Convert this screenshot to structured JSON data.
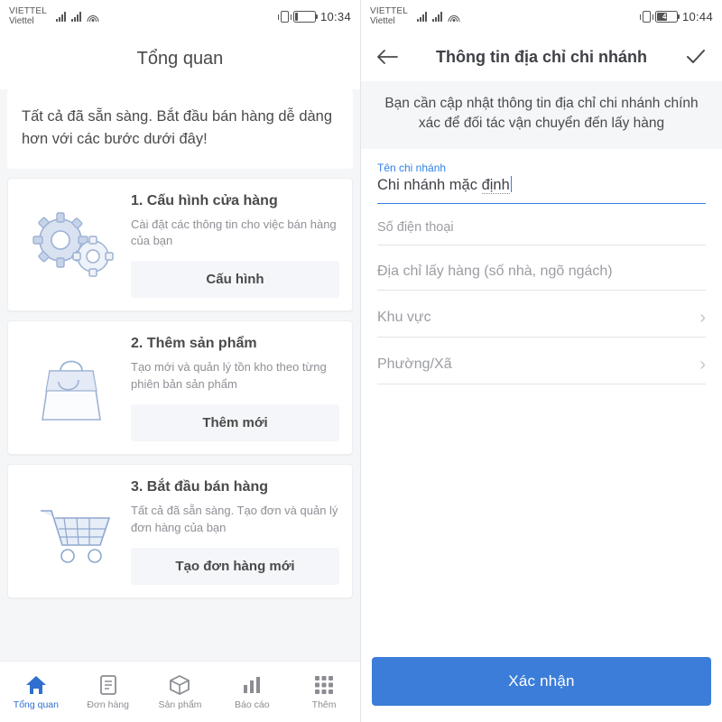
{
  "left": {
    "status": {
      "carrier_line1": "VIETTEL",
      "carrier_line2": "Viettel",
      "battery_level": "5",
      "clock": "10:34"
    },
    "title": "Tổng quan",
    "intro": "Tất cả đã sẵn sàng. Bắt đầu bán hàng dễ dàng hơn với các bước dưới đây!",
    "cards": [
      {
        "illus": "gears-illustration",
        "title": "1. Cấu hình cửa hàng",
        "desc": "Cài đặt các thông tin cho việc bán hàng của bạn",
        "button": "Cấu hình"
      },
      {
        "illus": "shopping-bag-illustration",
        "title": "2. Thêm sản phẩm",
        "desc": "Tạo mới và quản lý tồn kho theo từng phiên bản sản phẩm",
        "button": "Thêm mới"
      },
      {
        "illus": "shopping-cart-illustration",
        "title": "3. Bắt đầu bán hàng",
        "desc": "Tất cả đã sẵn sàng. Tạo đơn và quản lý đơn hàng của bạn",
        "button": "Tạo đơn hàng mới"
      }
    ],
    "nav": [
      {
        "icon": "home-icon",
        "label": "Tổng quan",
        "active": true
      },
      {
        "icon": "orders-icon",
        "label": "Đơn hàng",
        "active": false
      },
      {
        "icon": "product-box-icon",
        "label": "Sản phẩm",
        "active": false
      },
      {
        "icon": "report-chart-icon",
        "label": "Báo cáo",
        "active": false
      },
      {
        "icon": "grid-more-icon",
        "label": "Thêm",
        "active": false
      }
    ]
  },
  "right": {
    "status": {
      "carrier_line1": "VIETTEL",
      "carrier_line2": "Viettel",
      "battery_level": "47",
      "clock": "10:44"
    },
    "appbar": {
      "back_icon": "back-arrow-icon",
      "title": "Thông tin địa chỉ chi nhánh",
      "confirm_icon": "check-icon"
    },
    "notice": "Bạn cần cập nhật thông tin địa chỉ chi nhánh chính xác để đối tác vận chuyển đến lấy hàng",
    "fields": {
      "branch_name": {
        "label": "Tên chi nhánh",
        "value_prefix": "Chi nhánh mặc ",
        "value_suffix": "định"
      },
      "phone": {
        "placeholder": "Số điện thoại"
      },
      "address": {
        "placeholder": "Địa chỉ lấy hàng (số nhà, ngõ ngách)"
      },
      "region": {
        "placeholder": "Khu vực",
        "chevron": "chevron-right-icon"
      },
      "ward": {
        "placeholder": "Phường/Xã",
        "chevron": "chevron-right-icon"
      }
    },
    "confirm_button": "Xác nhận"
  },
  "colors": {
    "accent": "#2f80e8",
    "button": "#3b7dd8",
    "muted": "#9b9da3",
    "text": "#4a4a4a"
  }
}
